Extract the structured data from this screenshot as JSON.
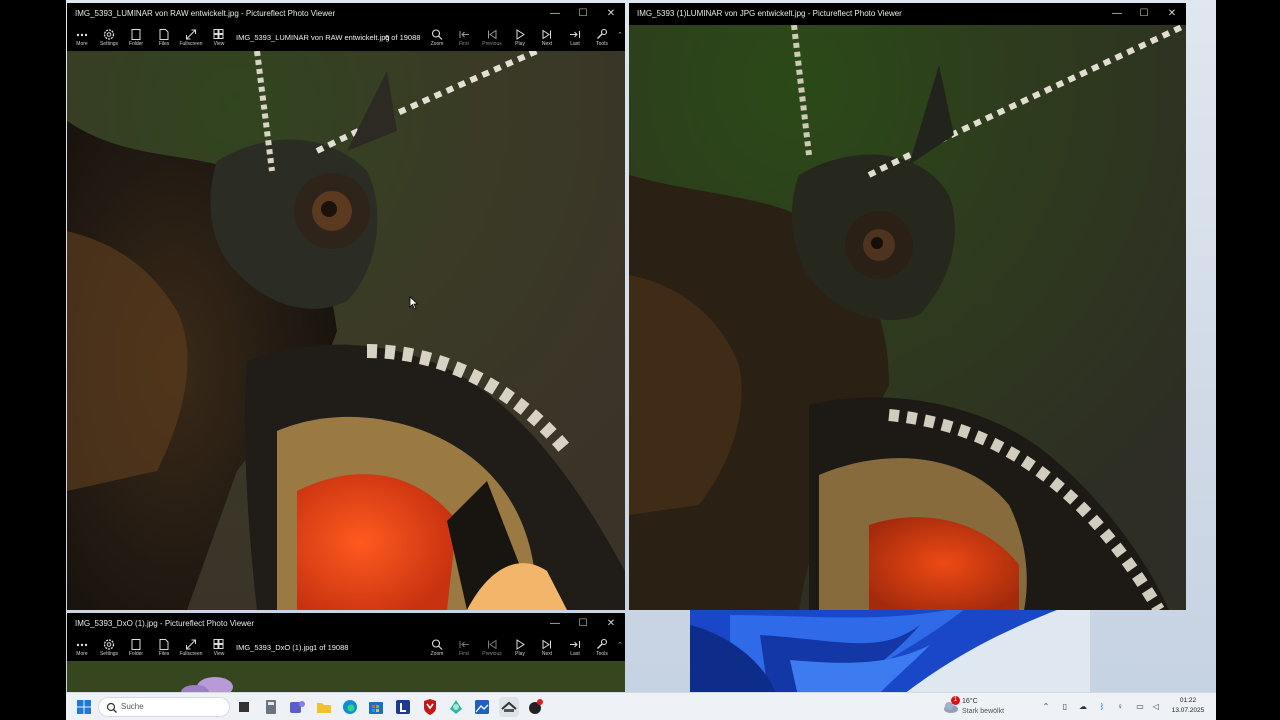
{
  "toolbar_labels": {
    "more": "More",
    "settings": "Settings",
    "folder": "Folder",
    "files": "Files",
    "fullscreen": "Fullscreen",
    "view": "View",
    "zoom": "Zoom",
    "first": "First",
    "previous": "Previous",
    "play": "Play",
    "next": "Next",
    "last": "Last",
    "tools": "Tools"
  },
  "windows": {
    "luminar_raw": {
      "title": "IMG_5393_LUMINAR von RAW entwickelt.jpg - Pictureflect Photo Viewer",
      "filename": "IMG_5393_LUMINAR von RAW entwickelt.jpg",
      "counter": "6 of 19088"
    },
    "luminar_jpg": {
      "title": "IMG_5393 (1)LUMINAR von JPG entwickelt.jpg - Pictureflect Photo Viewer"
    },
    "dxo": {
      "title": "IMG_5393_DxO (1).jpg - Pictureflect Photo Viewer",
      "filename": "IMG_5393_DxO (1).jpg",
      "counter": "1 of 19088"
    }
  },
  "window_controls": {
    "minimize": "—",
    "maximize": "☐",
    "close": "✕"
  },
  "taskbar": {
    "search_placeholder": "Suche",
    "weather": {
      "temp": "16°C",
      "condition": "Stark bewölkt",
      "badge": "1"
    },
    "clock": {
      "time": "01:22",
      "date": "13.07.2025"
    }
  },
  "colors": {
    "accent": "#1f6fd8",
    "titlebar": "#000000",
    "taskbar": "#eef1f5"
  }
}
